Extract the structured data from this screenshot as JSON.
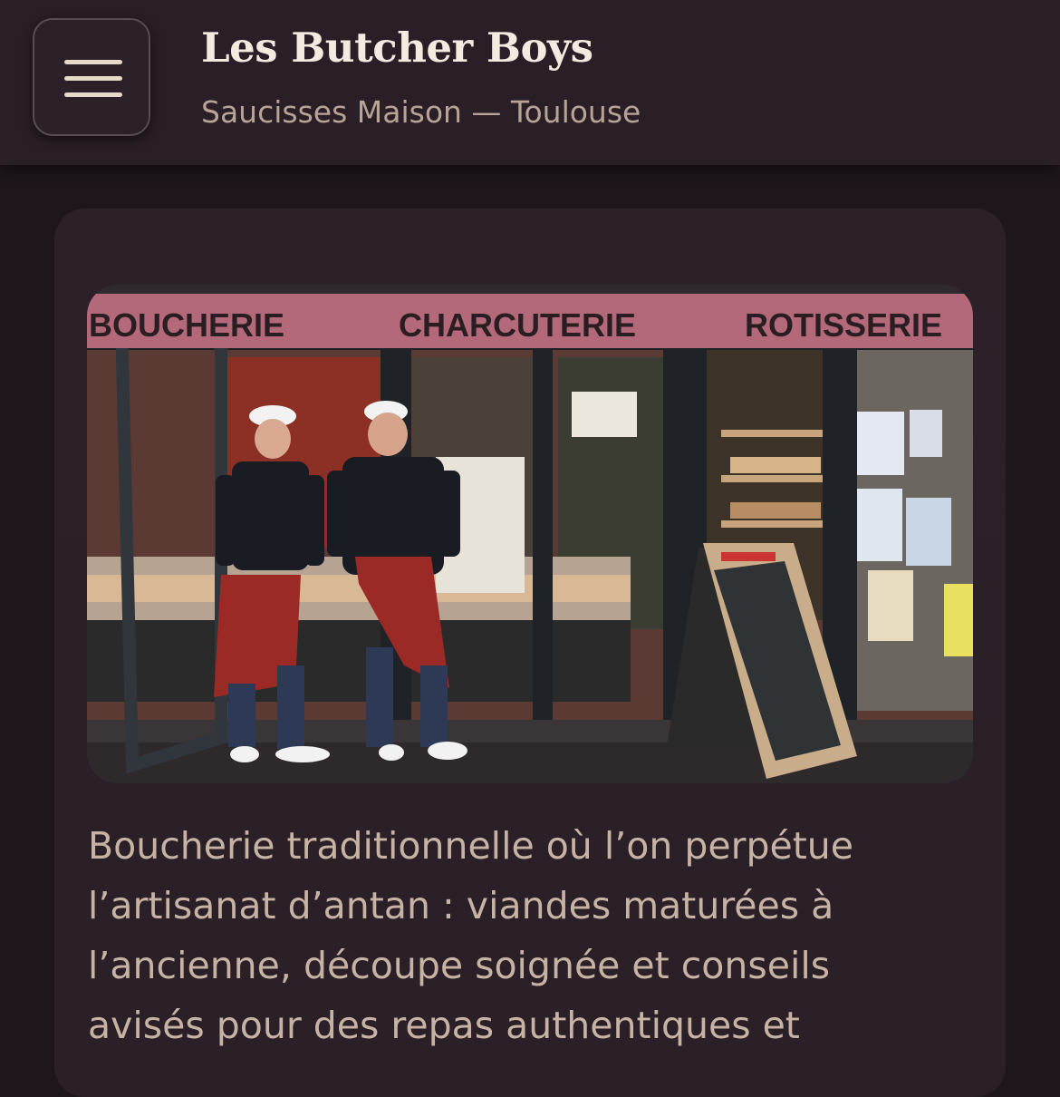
{
  "header": {
    "title": "Les Butcher Boys",
    "subtitle": "Saucisses Maison — Toulouse",
    "menu_icon": "hamburger-menu-icon"
  },
  "storefront": {
    "sign_words": [
      "BOUCHERIE",
      "CHARCUTERIE",
      "ROTISSERIE"
    ]
  },
  "description": "Boucherie traditionnelle où l’on perpétue l’artisanat d’antan : viandes maturées à l’ancienne, découpe soignée et conseils avisés pour des repas authentiques et",
  "colors": {
    "page_bg": "#1e161c",
    "header_bg": "#2a1e27",
    "card_bg": "#2c2029",
    "title": "#f3ebe0",
    "subtitle": "#b7a496",
    "body_text": "#c6b3a3",
    "awning": "#b3697a"
  }
}
